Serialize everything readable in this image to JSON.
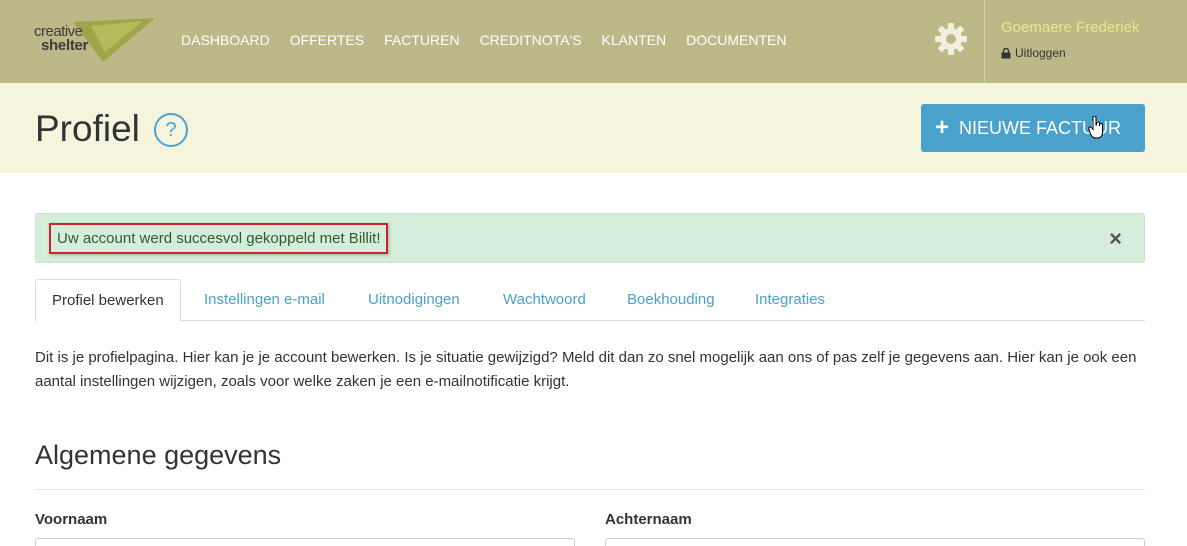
{
  "brand": {
    "line1": "creative",
    "line2": "shelter",
    "trademark": "™"
  },
  "nav": {
    "items": [
      {
        "label": "DASHBOARD"
      },
      {
        "label": "OFFERTES"
      },
      {
        "label": "FACTUREN"
      },
      {
        "label": "CREDITNOTA'S"
      },
      {
        "label": "KLANTEN"
      },
      {
        "label": "DOCUMENTEN"
      }
    ],
    "settings_icon": "gear-icon",
    "user_name": "Goemaere Frederiek",
    "logout_label": "Uitloggen"
  },
  "header": {
    "title": "Profiel",
    "help_symbol": "?",
    "new_invoice_label": "NIEUWE FACTUUR",
    "plus_symbol": "+"
  },
  "alert": {
    "message": "Uw account werd succesvol gekoppeld met Billit!",
    "close_symbol": "×"
  },
  "tabs": [
    {
      "label": "Profiel bewerken",
      "active": true
    },
    {
      "label": "Instellingen e-mail",
      "active": false
    },
    {
      "label": "Uitnodigingen",
      "active": false
    },
    {
      "label": "Wachtwoord",
      "active": false
    },
    {
      "label": "Boekhouding",
      "active": false
    },
    {
      "label": "Integraties",
      "active": false
    }
  ],
  "intro_text": "Dit is je profielpagina. Hier kan je je account bewerken. Is je situatie gewijzigd? Meld dit dan zo snel mogelijk aan ons of pas zelf je gegevens aan. Hier kan je ook een aantal instellingen wijzigen, zoals voor welke zaken je een e-mailnotificatie krijgt.",
  "section": {
    "title": "Algemene gegevens",
    "fields": [
      {
        "label": "Voornaam",
        "value": ""
      },
      {
        "label": "Achternaam",
        "value": ""
      }
    ]
  },
  "colors": {
    "topbar": "#bdb887",
    "titleband": "#f5f4dd",
    "accent": "#4aa1cc",
    "alert_bg": "#d4eedb",
    "highlight_border": "#d0222a",
    "user_name": "#e7ea8a"
  }
}
